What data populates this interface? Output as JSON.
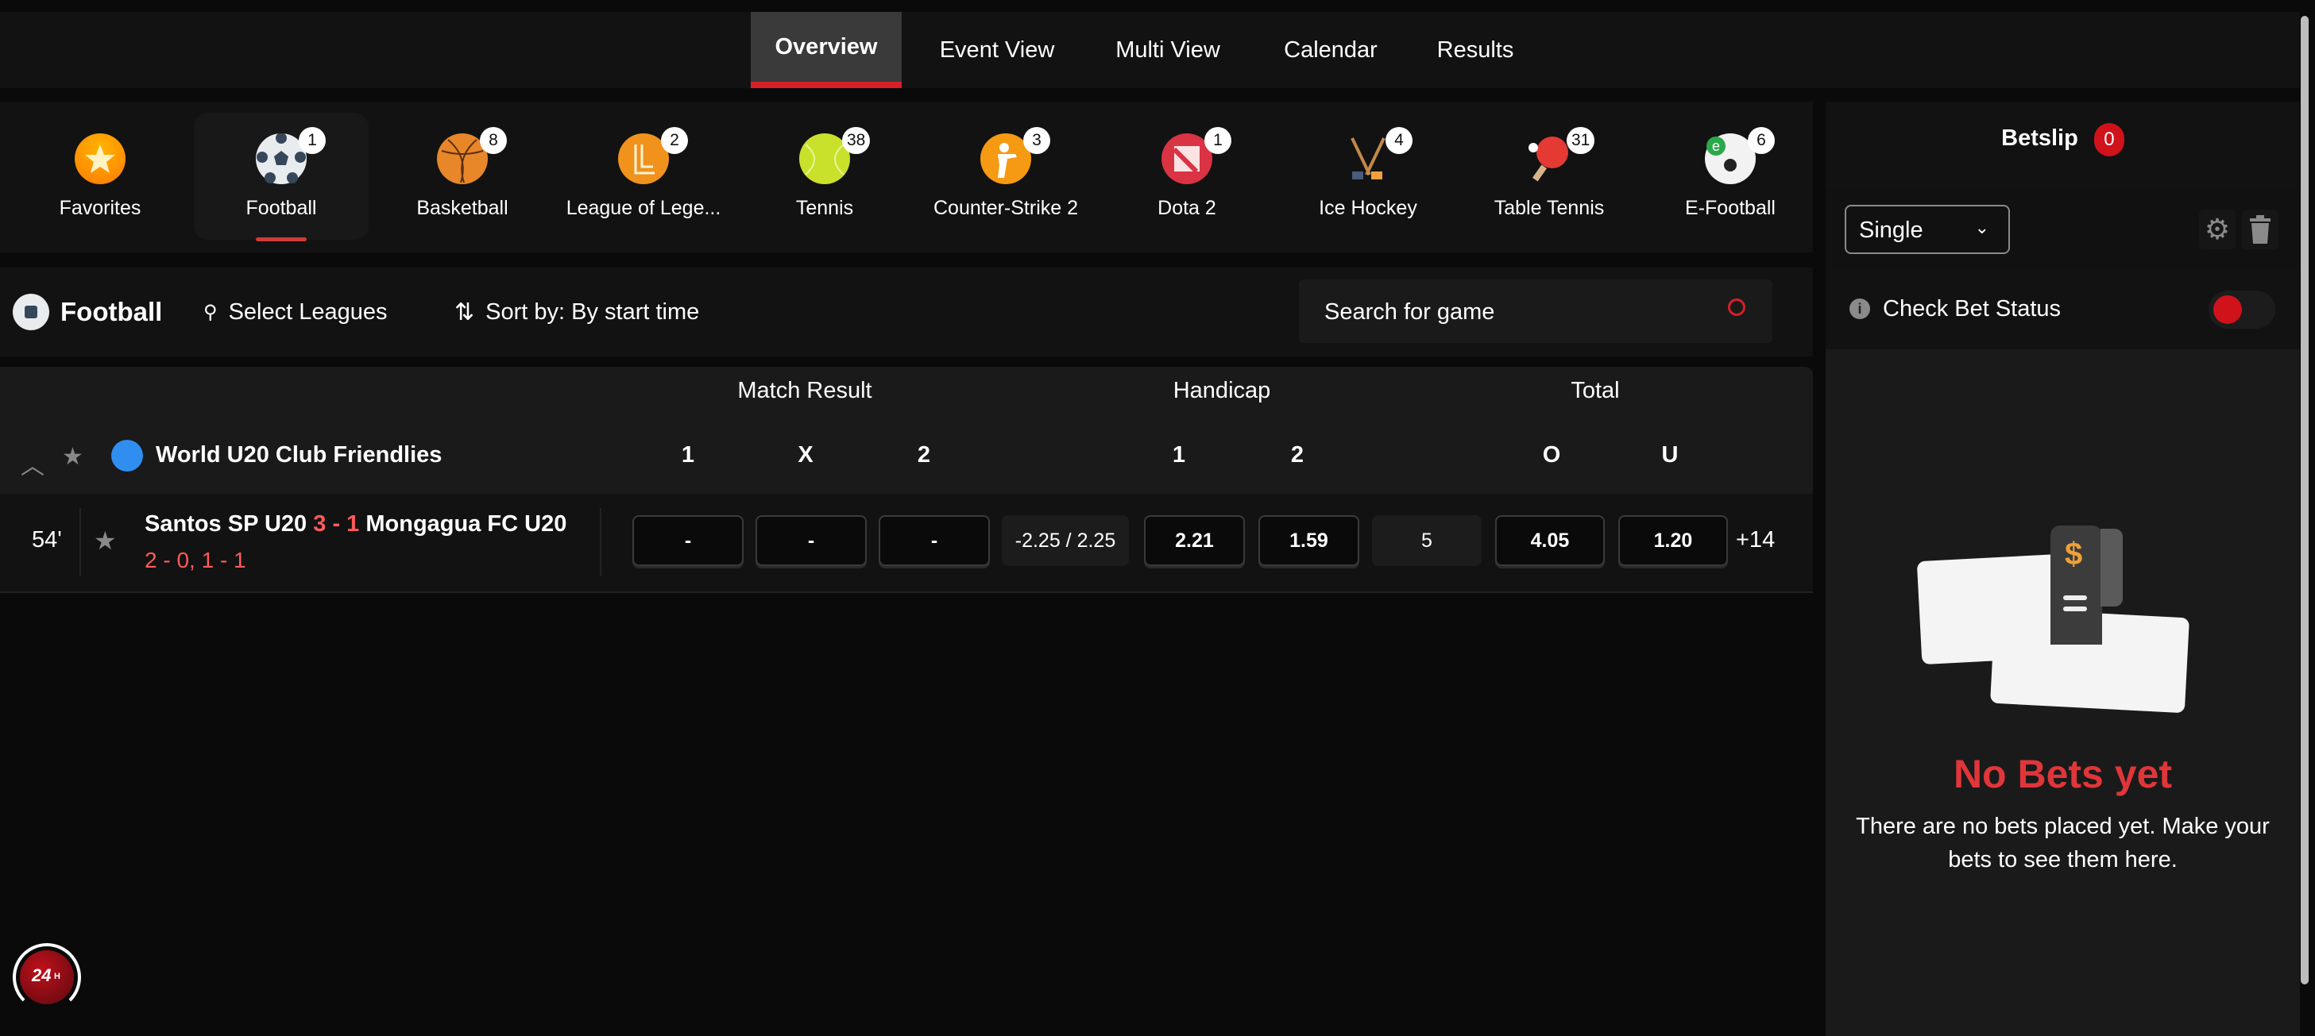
{
  "top_nav": {
    "tabs": [
      {
        "label": "Overview",
        "active": true
      },
      {
        "label": "Event View",
        "active": false
      },
      {
        "label": "Multi View",
        "active": false
      },
      {
        "label": "Calendar",
        "active": false
      },
      {
        "label": "Results",
        "active": false
      }
    ]
  },
  "sports": [
    {
      "label": "Favorites",
      "icon": "star-icon",
      "count": null,
      "active": false
    },
    {
      "label": "Football",
      "icon": "soccer-ball-icon",
      "count": "1",
      "active": true
    },
    {
      "label": "Basketball",
      "icon": "basketball-icon",
      "count": "8",
      "active": false
    },
    {
      "label": "League of Lege...",
      "icon": "league-of-legends-icon",
      "count": "2",
      "active": false
    },
    {
      "label": "Tennis",
      "icon": "tennis-ball-icon",
      "count": "38",
      "active": false
    },
    {
      "label": "Counter-Strike 2",
      "icon": "counter-strike-icon",
      "count": "3",
      "active": false
    },
    {
      "label": "Dota 2",
      "icon": "dota-icon",
      "count": "1",
      "active": false
    },
    {
      "label": "Ice Hockey",
      "icon": "hockey-sticks-icon",
      "count": "4",
      "active": false
    },
    {
      "label": "Table Tennis",
      "icon": "ping-pong-icon",
      "count": "31",
      "active": false
    },
    {
      "label": "E-Football",
      "icon": "e-football-icon",
      "count": "6",
      "active": false
    }
  ],
  "filter_bar": {
    "sport_title": "Football",
    "select_leagues": "Select Leagues",
    "sort_label": "Sort by: By start time",
    "search_placeholder": "Search for game"
  },
  "table": {
    "markets": [
      "Match Result",
      "Handicap",
      "Total"
    ],
    "columns": [
      "1",
      "X",
      "2",
      "1",
      "2",
      "O",
      "U"
    ],
    "league": "World U20 Club Friendlies",
    "matches": [
      {
        "minute": "54'",
        "home": "Santos SP U20",
        "score_home": "3",
        "score_sep": "-",
        "score_away": "1",
        "away": "Mongagua FC U20",
        "period_scores": "2 - 0, 1 - 1",
        "match_result": [
          "-",
          "-",
          "-"
        ],
        "handicap_line": "-2.25 / 2.25",
        "handicap": [
          "2.21",
          "1.59"
        ],
        "total_line": "5",
        "total": [
          "4.05",
          "1.20"
        ],
        "more_markets": "+14"
      }
    ]
  },
  "betslip": {
    "title": "Betslip",
    "count": "0",
    "bet_type": "Single",
    "check_status_label": "Check Bet Status",
    "empty_title": "No Bets yet",
    "empty_text": "There are no bets placed yet. Make your bets to see them here."
  },
  "support": {
    "label": "24",
    "suffix": "H"
  },
  "colors": {
    "accent": "#d61f26",
    "badge_red": "#d0121b",
    "empty_title": "#e0363a",
    "score_red": "#ff5a5a"
  }
}
